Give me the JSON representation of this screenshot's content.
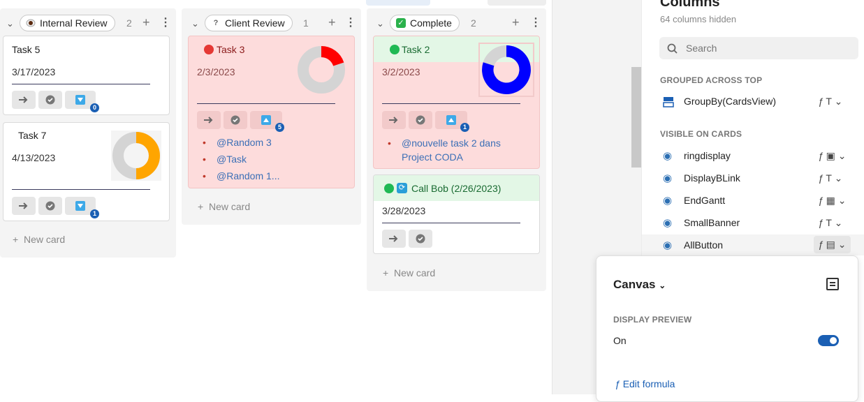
{
  "columns": [
    {
      "name": "Internal Review",
      "count": "2",
      "cards": [
        {
          "title": "Task 5",
          "date": "3/17/2023",
          "badge": "0"
        },
        {
          "title": "Task 7",
          "date": "4/13/2023",
          "badge": "1",
          "ring_value": 0.5,
          "ring_color": "#ffa500"
        }
      ],
      "new_card": "New card"
    },
    {
      "name": "Client Review",
      "count": "1",
      "cards": [
        {
          "title": "Task 3",
          "date": "2/3/2023",
          "badge": "5",
          "ring_value": 0.2,
          "ring_color": "#ff0000",
          "links": [
            "@Random 3",
            "@Task",
            "@Random 1..."
          ]
        }
      ],
      "new_card": "New card"
    },
    {
      "name": "Complete",
      "count": "2",
      "cards": [
        {
          "title": "Task 2",
          "date": "3/2/2023",
          "badge": "1",
          "ring_value": 0.8,
          "ring_color": "#0000ff",
          "links": [
            "@nouvelle task 2 dans Project CODA"
          ]
        },
        {
          "title": "Call Bob (2/26/2023)",
          "date": "3/28/2023"
        }
      ],
      "new_card": "New card"
    }
  ],
  "panel": {
    "title": "Columns",
    "subtitle": "64 columns hidden",
    "search_placeholder": "Search",
    "grouped_header": "GROUPED ACROSS TOP",
    "grouped_item": "GroupBy(CardsView)",
    "visible_header": "VISIBLE ON CARDS",
    "visible_items": [
      "ringdisplay",
      "DisplayBLink",
      "EndGantt",
      "SmallBanner",
      "AllButton"
    ]
  },
  "popup": {
    "title": "Canvas",
    "section": "DISPLAY PREVIEW",
    "toggle_label": "On",
    "edit_formula": "Edit formula"
  },
  "colors": {
    "accent": "#1a5fb4",
    "pink_card": "#fddcdc",
    "green_header": "#e3f7e6"
  }
}
